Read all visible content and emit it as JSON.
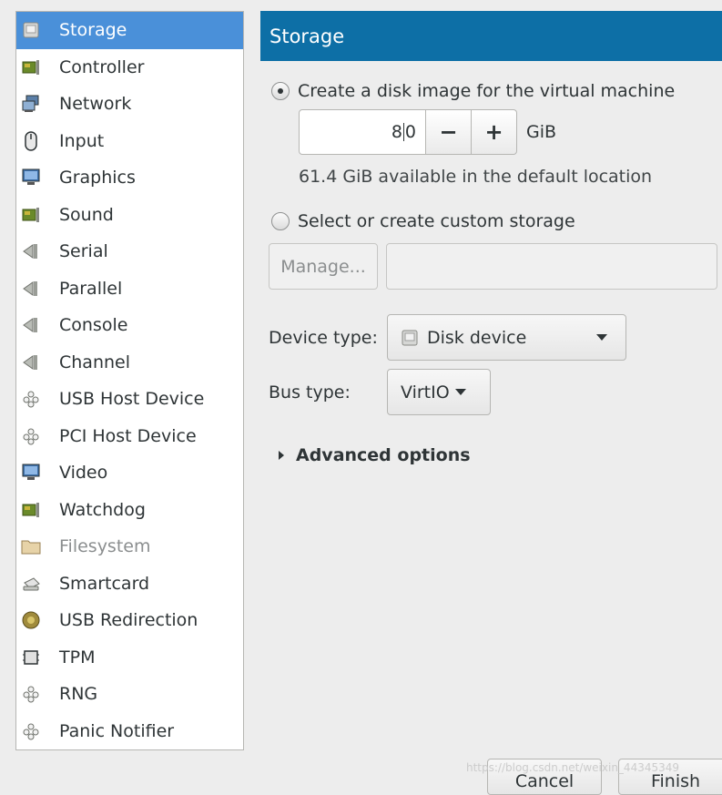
{
  "sidebar": {
    "items": [
      {
        "label": "Storage",
        "icon": "disk-icon"
      },
      {
        "label": "Controller",
        "icon": "controller-card-icon"
      },
      {
        "label": "Network",
        "icon": "network-icon"
      },
      {
        "label": "Input",
        "icon": "mouse-icon"
      },
      {
        "label": "Graphics",
        "icon": "monitor-icon"
      },
      {
        "label": "Sound",
        "icon": "sound-card-icon"
      },
      {
        "label": "Serial",
        "icon": "serial-port-icon"
      },
      {
        "label": "Parallel",
        "icon": "parallel-port-icon"
      },
      {
        "label": "Console",
        "icon": "console-port-icon"
      },
      {
        "label": "Channel",
        "icon": "channel-port-icon"
      },
      {
        "label": "USB Host Device",
        "icon": "usb-device-icon"
      },
      {
        "label": "PCI Host Device",
        "icon": "pci-device-icon"
      },
      {
        "label": "Video",
        "icon": "monitor-icon"
      },
      {
        "label": "Watchdog",
        "icon": "watchdog-card-icon"
      },
      {
        "label": "Filesystem",
        "icon": "folder-icon"
      },
      {
        "label": "Smartcard",
        "icon": "smartcard-reader-icon"
      },
      {
        "label": "USB Redirection",
        "icon": "usb-redirection-icon"
      },
      {
        "label": "TPM",
        "icon": "tpm-chip-icon"
      },
      {
        "label": "RNG",
        "icon": "rng-device-icon"
      },
      {
        "label": "Panic Notifier",
        "icon": "panic-notifier-icon"
      }
    ],
    "selected_index": 0,
    "disabled_index": 14
  },
  "header": {
    "title": "Storage"
  },
  "storage": {
    "create_radio_label": "Create a disk image for the virtual machine",
    "size_value_before_cursor": "8",
    "size_value_after_cursor": "0",
    "decrement_label": "−",
    "increment_label": "+",
    "unit": "GiB",
    "available_note": "61.4 GiB available in the default location",
    "custom_radio_label": "Select or create custom storage",
    "manage_label": "Manage...",
    "custom_path_value": ""
  },
  "device_type": {
    "label": "Device type:",
    "value": "Disk device",
    "icon": "disk-icon"
  },
  "bus_type": {
    "label": "Bus type:",
    "value": "VirtIO"
  },
  "advanced": {
    "label": "Advanced options"
  },
  "footer": {
    "cancel_label": "Cancel",
    "finish_label": "Finish"
  },
  "watermark": "https://blog.csdn.net/weixin_44345349",
  "colors": {
    "header_bg": "#0d6fa6",
    "selection_bg": "#4a90d9"
  }
}
